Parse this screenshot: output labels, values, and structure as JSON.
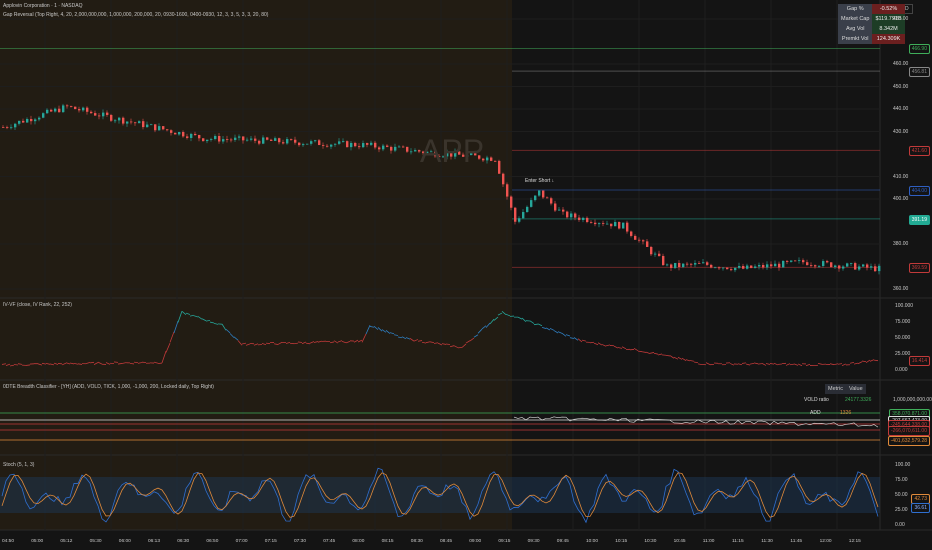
{
  "header": {
    "symbol_title": "Applovin Corporation · 1 · NASDAQ",
    "indicator_gap": "Gap Reversal (Top Right, 4, 20, 2,000,000,000, 1,000,000, 200,000, 20, 0930-1600, 0400-0930, 12, 3, 3, 5, 3, 3, 20, 80)",
    "watermark": "APP",
    "currency": "USD"
  },
  "stats_table": [
    {
      "k": "Gap %",
      "v": "-0.52%",
      "c": "#6b1f1f"
    },
    {
      "k": "Market Cap",
      "v": "$119.791B",
      "c": "#1d3d26"
    },
    {
      "k": "Avg Vol",
      "v": "8.342M",
      "c": "#1d3d26"
    },
    {
      "k": "Premkt Vol",
      "v": "124.309K",
      "c": "#6b1f1f"
    }
  ],
  "price_axis": {
    "ticks": [
      {
        "p": 480,
        "t": "480.00"
      },
      {
        "p": 460,
        "t": "460.00"
      },
      {
        "p": 450,
        "t": "450.00"
      },
      {
        "p": 440,
        "t": "440.00"
      },
      {
        "p": 430,
        "t": "430.00"
      },
      {
        "p": 410,
        "t": "410.00"
      },
      {
        "p": 400,
        "t": "400.00"
      },
      {
        "p": 380,
        "t": "380.00"
      },
      {
        "p": 360,
        "t": "360.00"
      }
    ],
    "labels": [
      {
        "p": 466.9,
        "t": "466.90",
        "c": "#3fae5a"
      },
      {
        "p": 456.81,
        "t": "456.81",
        "c": "#888888"
      },
      {
        "p": 421.6,
        "t": "421.60",
        "c": "#c23a3a"
      },
      {
        "p": 404,
        "t": "404.00",
        "c": "#2f5fc2"
      },
      {
        "p": 391.19,
        "t": "391.19",
        "c": "#22ab94",
        "fill": true
      },
      {
        "p": 369.59,
        "t": "369.59",
        "c": "#c23a3a"
      }
    ]
  },
  "annotation": "Enter Short ↓",
  "price_anchors": [
    [
      0,
      432
    ],
    [
      16,
      441
    ],
    [
      25,
      437
    ],
    [
      50,
      427
    ],
    [
      90,
      424
    ],
    [
      105,
      421
    ],
    [
      123,
      418
    ],
    [
      128,
      390
    ],
    [
      134,
      403
    ],
    [
      140,
      393
    ],
    [
      155,
      388
    ],
    [
      166,
      370
    ],
    [
      175,
      371
    ],
    [
      185,
      369
    ],
    [
      200,
      372
    ],
    [
      219,
      369
    ]
  ],
  "ivr": {
    "title": "IV-VF (close, IV Rank, 22, 252)",
    "ticks": [
      "100.000",
      "75.000",
      "50.000",
      "25.000",
      "0.000"
    ],
    "last": "16.414",
    "anchors": [
      [
        0,
        8
      ],
      [
        40,
        12
      ],
      [
        45,
        90
      ],
      [
        55,
        70
      ],
      [
        60,
        40
      ],
      [
        90,
        45
      ],
      [
        92,
        70
      ],
      [
        100,
        50
      ],
      [
        115,
        35
      ],
      [
        125,
        90
      ],
      [
        132,
        75
      ],
      [
        145,
        45
      ],
      [
        160,
        30
      ],
      [
        175,
        10
      ],
      [
        210,
        8
      ],
      [
        219,
        16
      ]
    ]
  },
  "breadth": {
    "title": "0DTE Breadth Classifier - [YH] (ADD, VOLD, TICK, 1,000, -1,000, 200, Locked daily, Top Right)",
    "table_headers": [
      "Metric",
      "Value"
    ],
    "rows": [
      {
        "k": "VOLD ratio",
        "v": "24177.3326",
        "c": "#3fae5a"
      },
      {
        "k": "ADD",
        "v": "1326",
        "c": "#e08a3a"
      }
    ],
    "axis_top": "1,000,000,000.00",
    "labels": [
      {
        "t": "358,070,871.00",
        "c": "#3fae5a"
      },
      {
        "t": "-207,667,423.00",
        "c": "#dddddd"
      },
      {
        "t": "-245,644,338.00",
        "c": "#c23a3a"
      },
      {
        "t": "-266,070,611.00",
        "c": "#c23a3a"
      },
      {
        "t": "-401,632,579.28",
        "c": "#e08a3a"
      }
    ]
  },
  "stoch": {
    "title": "Stoch (5, 1, 3)",
    "ticks": [
      "100.00",
      "75.00",
      "50.00",
      "25.00",
      "0.00"
    ],
    "k": "42.73",
    "d": "36.61"
  },
  "time_axis": [
    "04:50",
    "05:00",
    "05:12",
    "05:30",
    "06:00",
    "06:13",
    "06:30",
    "06:50",
    "07:00",
    "07:15",
    "07:30",
    "07:45",
    "08:00",
    "08:15",
    "08:30",
    "08:45",
    "09:00",
    "09:15",
    "09:30",
    "09:45",
    "10:00",
    "10:15",
    "10:30",
    "10:45",
    "11:00",
    "11:15",
    "11:30",
    "11:45",
    "12:00",
    "12:15"
  ],
  "colors": {
    "up": "#26a69a",
    "down": "#ef5350",
    "premarket": "#221c13"
  }
}
